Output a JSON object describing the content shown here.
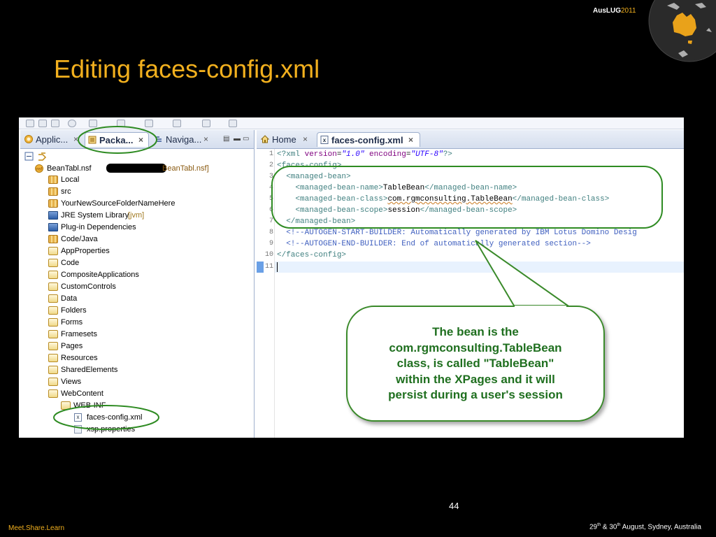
{
  "header": {
    "brand_main": "AusLUG",
    "brand_year": "2011",
    "title": "Editing faces-config.xml"
  },
  "left_pane": {
    "tabs": [
      {
        "label": "Applic...",
        "close": "×"
      },
      {
        "label": "Packa...",
        "close": "×"
      },
      {
        "label": "Naviga...",
        "close": "×"
      }
    ],
    "tree": {
      "root_label": "BeanTabl.nsf",
      "root_suffix": "BeanTabl.nsf]",
      "items": [
        "Local",
        "src",
        "YourNewSourceFolderNameHere",
        "JRE System Library",
        "Plug-in Dependencies",
        "Code/Java",
        "AppProperties",
        "Code",
        "CompositeApplications",
        "CustomControls",
        "Data",
        "Folders",
        "Forms",
        "Framesets",
        "Pages",
        "Resources",
        "SharedElements",
        "Views",
        "WebContent"
      ],
      "jre_suffix": "[jvm]",
      "webinf_label": "WEB-INF",
      "faces_label": "faces-config.xml",
      "xsp_label": "xsp.properties"
    }
  },
  "right_pane": {
    "tabs": [
      {
        "label": "Home",
        "close": "×"
      },
      {
        "label": "faces-config.xml",
        "close": "×"
      }
    ],
    "line_numbers": [
      "1",
      "2",
      "3",
      "4",
      "5",
      "6",
      "7",
      "8",
      "9",
      "10",
      "11"
    ],
    "code": {
      "l1_open": "<?xml ",
      "l1_attr1": "version",
      "l1_eq1": "=",
      "l1_val1": "\"1.0\"",
      "l1_attr2": " encoding",
      "l1_eq2": "=",
      "l1_val2": "\"UTF-8\"",
      "l1_close": "?>",
      "l2": "<faces-config>",
      "l3": "  <managed-bean>",
      "l4_open": "    <managed-bean-name>",
      "l4_text": "TableBean",
      "l4_close": "</managed-bean-name>",
      "l5_open": "    <managed-bean-class>",
      "l5_text": "com.rgmconsulting.TableBean",
      "l5_close": "</managed-bean-class>",
      "l6_open": "    <managed-bean-scope>",
      "l6_text": "session",
      "l6_close": "</managed-bean-scope>",
      "l7": "  </managed-bean>",
      "l8": "  <!--AUTOGEN-START-BUILDER: Automatically generated by IBM Lotus Domino Desig",
      "l9": "  <!--AUTOGEN-END-BUILDER: End of automatically generated section-->",
      "l10": "</faces-config>",
      "l11": ""
    }
  },
  "callout": {
    "line1": "The bean is the",
    "line2": "com.rgmconsulting.TableBean",
    "line3": "class, is called \"TableBean\"",
    "line4": "within the XPages and it will",
    "line5": "persist during a user's session"
  },
  "footer": {
    "page_number": "44",
    "tagline": "Meet.Share.Learn",
    "date_d1": "29",
    "date_sup1": "th",
    "date_amp": " & ",
    "date_d2": "30",
    "date_sup2": "th",
    "date_rest": " August, Sydney, Australia"
  },
  "colors": {
    "title": "#f2b01e",
    "callout_border": "#3a8a2a",
    "callout_text": "#1f6f1f",
    "highlight_oval": "#2e8b22"
  }
}
